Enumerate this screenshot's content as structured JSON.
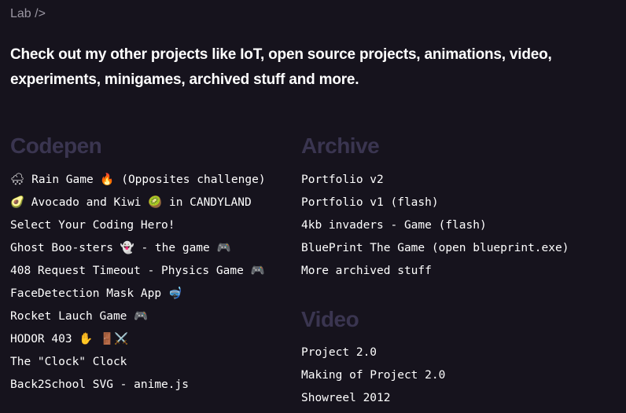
{
  "breadcrumb": "Lab />",
  "intro": "Check out my other projects like IoT, open source projects, animations, video, experiments, minigames, archived stuff and more.",
  "codepen": {
    "title": "Codepen",
    "items": [
      "🌨 Rain Game 🔥 (Opposites challenge)",
      "🥑 Avocado and Kiwi 🥝 in CANDYLAND",
      "Select Your Coding Hero!",
      "Ghost Boo-sters 👻 - the game 🎮",
      "408 Request Timeout - Physics Game 🎮",
      "FaceDetection Mask App 🤿",
      "Rocket Lauch Game 🎮",
      "HODOR 403 ✋ 🚪⚔️",
      "The \"Clock\" Clock",
      "Back2School SVG - anime.js"
    ]
  },
  "archive": {
    "title": "Archive",
    "items": [
      "Portfolio v2",
      "Portfolio v1 (flash)",
      "4kb invaders - Game (flash)",
      "BluePrint The Game (open blueprint.exe)",
      "More archived stuff"
    ]
  },
  "video": {
    "title": "Video",
    "items": [
      "Project 2.0",
      "Making of Project 2.0",
      "Showreel 2012"
    ]
  }
}
